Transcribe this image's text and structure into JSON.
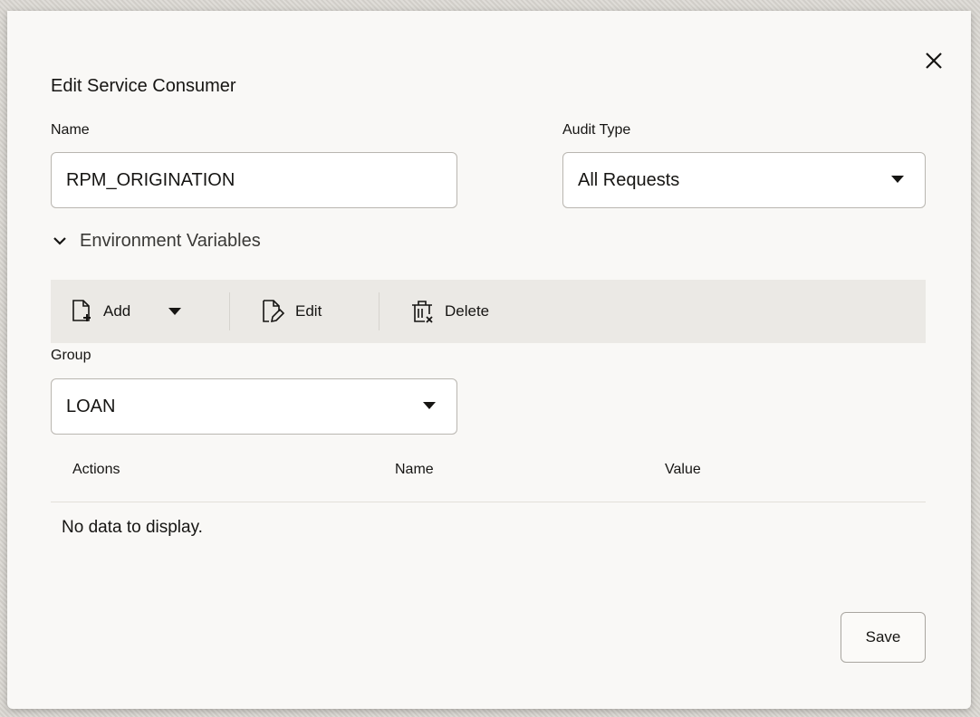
{
  "dialog": {
    "title": "Edit Service Consumer",
    "close_icon": "close-icon"
  },
  "form": {
    "name_label": "Name",
    "name_value": "RPM_ORIGINATION",
    "audit_type_label": "Audit Type",
    "audit_type_value": "All Requests"
  },
  "env_section": {
    "label": "Environment Variables",
    "expanded": true
  },
  "toolbar": {
    "add_label": "Add",
    "edit_label": "Edit",
    "delete_label": "Delete"
  },
  "group": {
    "label": "Group",
    "value": "LOAN"
  },
  "table": {
    "columns": [
      "Actions",
      "Name",
      "Value"
    ],
    "empty_text": "No data to display."
  },
  "footer": {
    "save_label": "Save"
  },
  "colors": {
    "dialog_bg": "#f9f8f6",
    "toolbar_bg": "#ebe9e5",
    "text": "#161513"
  }
}
